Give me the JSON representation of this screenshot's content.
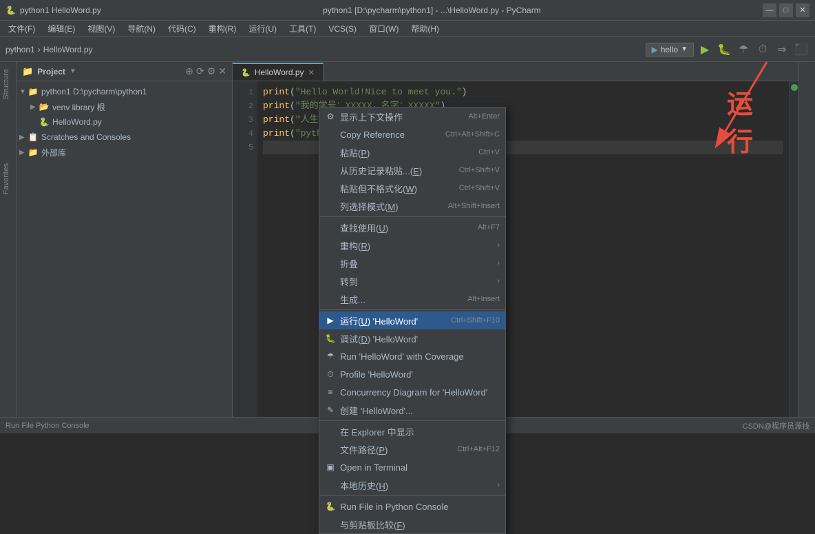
{
  "titleBar": {
    "leftText": "python1  HelloWord.py",
    "centerText": "python1 [D:\\pycharm\\python1] - ...\\HelloWord.py - PyCharm",
    "minimizeBtn": "—",
    "maximizeBtn": "□",
    "closeBtn": "✕"
  },
  "menuBar": {
    "items": [
      "文件(F)",
      "编辑(E)",
      "视图(V)",
      "导航(N)",
      "代码(C)",
      "重构(R)",
      "运行(U)",
      "工具(T)",
      "VCS(S)",
      "窗口(W)",
      "帮助(H)"
    ]
  },
  "toolbar": {
    "project": "python1",
    "file": "HelloWord.py",
    "runConfig": "hello",
    "runBtn": "▶",
    "debugBtn": "🐛",
    "coverageBtn": "☂",
    "profileBtn": "⏱",
    "buildBtn": "🔨",
    "stopBtn": "⬛"
  },
  "projectPanel": {
    "title": "Project",
    "addBtn": "+",
    "syncBtn": "⟳",
    "settingsBtn": "⚙",
    "closeBtn": "✕",
    "tree": [
      {
        "indent": 0,
        "expanded": true,
        "icon": "folder",
        "label": "python1 D:\\pycharm\\python1",
        "id": "root"
      },
      {
        "indent": 1,
        "expanded": true,
        "icon": "folder",
        "label": "venv library 根",
        "id": "venv"
      },
      {
        "indent": 1,
        "expanded": false,
        "icon": "py",
        "label": "HelloWord.py",
        "id": "helloword"
      },
      {
        "indent": 0,
        "expanded": false,
        "icon": "scratches",
        "label": "Scratches and Consoles",
        "id": "scratches"
      },
      {
        "indent": 0,
        "expanded": false,
        "icon": "folder",
        "label": "外部库",
        "id": "external"
      }
    ]
  },
  "editor": {
    "tab": "HelloWord.py",
    "lines": [
      {
        "num": 1,
        "code": "print(\"Hello World!Nice to meet you.\")"
      },
      {
        "num": 2,
        "code": "print(\"我的学号：XXXXX，名字：XXXXX\")"
      },
      {
        "num": 3,
        "code": "print(\"人生苦短，我学python.\")"
      },
      {
        "num": 4,
        "code": "print(\"python,I love you so much\")"
      },
      {
        "num": 5,
        "code": ""
      }
    ]
  },
  "contextMenu": {
    "items": [
      {
        "id": "show-context",
        "icon": "⚙",
        "label": "显示上下文操作",
        "shortcut": "Alt+Enter",
        "hasArrow": false,
        "separator": false,
        "highlighted": false
      },
      {
        "id": "copy-reference",
        "icon": "",
        "label": "Copy Reference",
        "shortcut": "Ctrl+Alt+Shift+C",
        "hasArrow": false,
        "separator": false,
        "highlighted": false
      },
      {
        "id": "paste",
        "icon": "",
        "label": "粘贴(P)",
        "shortcut": "Ctrl+V",
        "hasArrow": false,
        "separator": false,
        "highlighted": false
      },
      {
        "id": "paste-history",
        "icon": "",
        "label": "从历史记录粘贴...(E)",
        "shortcut": "Ctrl+Shift+V",
        "hasArrow": false,
        "separator": false,
        "highlighted": false
      },
      {
        "id": "paste-plain",
        "icon": "",
        "label": "粘贴但不格式化(W)",
        "shortcut": "Ctrl+Shift+V",
        "hasArrow": false,
        "separator": false,
        "highlighted": false
      },
      {
        "id": "col-select",
        "icon": "",
        "label": "列选择模式(M)",
        "shortcut": "Alt+Shift+Insert",
        "hasArrow": false,
        "separator": false,
        "highlighted": false
      },
      {
        "id": "sep1",
        "separator": true
      },
      {
        "id": "find-usages",
        "icon": "",
        "label": "查找使用(U)",
        "shortcut": "Alt+F7",
        "hasArrow": false,
        "separator": false,
        "highlighted": false
      },
      {
        "id": "refactor",
        "icon": "",
        "label": "重构(R)",
        "shortcut": "",
        "hasArrow": true,
        "separator": false,
        "highlighted": false
      },
      {
        "id": "fold",
        "icon": "",
        "label": "折叠",
        "shortcut": "",
        "hasArrow": true,
        "separator": false,
        "highlighted": false
      },
      {
        "id": "goto",
        "icon": "",
        "label": "转到",
        "shortcut": "",
        "hasArrow": true,
        "separator": false,
        "highlighted": false
      },
      {
        "id": "generate",
        "icon": "",
        "label": "生成...",
        "shortcut": "Alt+Insert",
        "hasArrow": false,
        "separator": false,
        "highlighted": false
      },
      {
        "id": "sep2",
        "separator": true
      },
      {
        "id": "run-helloword",
        "icon": "▶",
        "label": "运行(U) 'HelloWord'",
        "shortcut": "Ctrl+Shift+F10",
        "hasArrow": false,
        "separator": false,
        "highlighted": true
      },
      {
        "id": "debug-helloword",
        "icon": "🐛",
        "label": "调试(D) 'HelloWord'",
        "shortcut": "",
        "hasArrow": false,
        "separator": false,
        "highlighted": false
      },
      {
        "id": "run-coverage",
        "icon": "☂",
        "label": "Run 'HelloWord' with Coverage",
        "shortcut": "",
        "hasArrow": false,
        "separator": false,
        "highlighted": false
      },
      {
        "id": "profile",
        "icon": "⏱",
        "label": "Profile 'HelloWord'",
        "shortcut": "",
        "hasArrow": false,
        "separator": false,
        "highlighted": false
      },
      {
        "id": "concurrency",
        "icon": "≡",
        "label": "Concurrency Diagram for 'HelloWord'",
        "shortcut": "",
        "hasArrow": false,
        "separator": false,
        "highlighted": false
      },
      {
        "id": "create-config",
        "icon": "✎",
        "label": "创建 'HelloWord'...",
        "shortcut": "",
        "hasArrow": false,
        "separator": false,
        "highlighted": false
      },
      {
        "id": "sep3",
        "separator": true
      },
      {
        "id": "show-explorer",
        "icon": "",
        "label": "在 Explorer 中显示",
        "shortcut": "",
        "hasArrow": false,
        "separator": false,
        "highlighted": false
      },
      {
        "id": "file-path",
        "icon": "",
        "label": "文件路径(P)",
        "shortcut": "Ctrl+Alt+F12",
        "hasArrow": false,
        "separator": false,
        "highlighted": false
      },
      {
        "id": "open-terminal",
        "icon": "▣",
        "label": "Open in Terminal",
        "shortcut": "",
        "hasArrow": false,
        "separator": false,
        "highlighted": false
      },
      {
        "id": "local-history",
        "icon": "",
        "label": "本地历史(H)",
        "shortcut": "",
        "hasArrow": true,
        "separator": false,
        "highlighted": false
      },
      {
        "id": "sep4",
        "separator": true
      },
      {
        "id": "run-python-console",
        "icon": "🐍",
        "label": "Run File in Python Console",
        "shortcut": "",
        "hasArrow": false,
        "separator": false,
        "highlighted": false
      },
      {
        "id": "compare",
        "icon": "",
        "label": "与剪贴板比较(F)",
        "shortcut": "",
        "hasArrow": false,
        "separator": false,
        "highlighted": false
      }
    ]
  },
  "annotation": {
    "text": "运行"
  },
  "statusBar": {
    "left": "Run File Python Console",
    "right": "CSDN@程序员源栈"
  }
}
